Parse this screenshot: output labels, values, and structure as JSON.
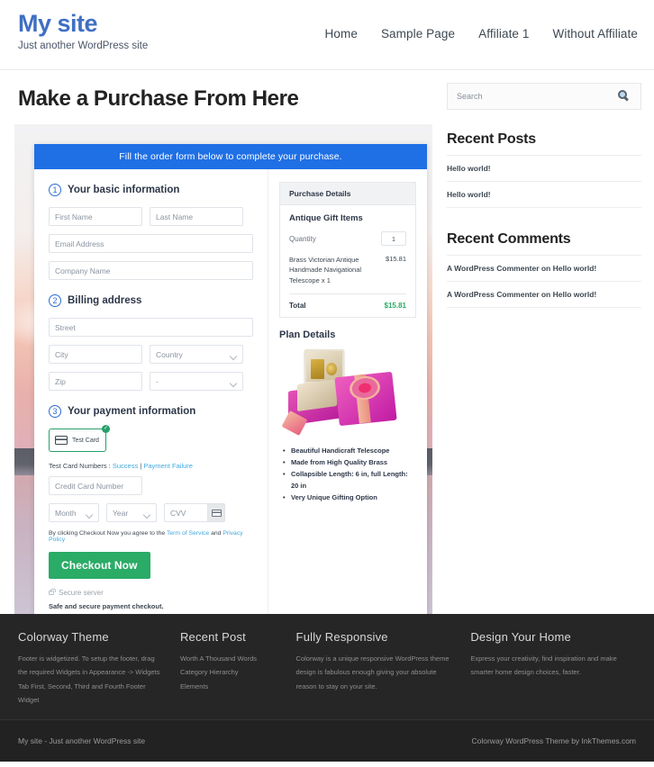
{
  "header": {
    "site_title": "My site",
    "tagline": "Just another WordPress site",
    "nav": [
      {
        "label": "Home"
      },
      {
        "label": "Sample Page"
      },
      {
        "label": "Affiliate 1"
      },
      {
        "label": "Without Affiliate"
      }
    ]
  },
  "page": {
    "title": "Make a Purchase From Here"
  },
  "checkout": {
    "banner": "Fill the order form below to complete your purchase.",
    "step1": {
      "num": "1",
      "label": "Your basic information",
      "first_name_placeholder": "First Name",
      "last_name_placeholder": "Last Name",
      "email_placeholder": "Email Address",
      "company_placeholder": "Company Name"
    },
    "step2": {
      "num": "2",
      "label": "Billing address",
      "street_placeholder": "Street",
      "city_placeholder": "City",
      "country_placeholder": "Country",
      "zip_placeholder": "Zip",
      "state_placeholder": "-"
    },
    "step3": {
      "num": "3",
      "label": "Your payment information",
      "test_card_label": "Test Card",
      "check_badge": "✓",
      "test_numbers_prefix": "Test Card Numbers : ",
      "test_numbers_success": "Success",
      "test_numbers_sep": " | ",
      "test_numbers_failure": "Payment Failure",
      "card_number_placeholder": "Credit Card Number",
      "month_placeholder": "Month",
      "year_placeholder": "Year",
      "cvv_placeholder": "CVV",
      "terms_prefix": "By clicking Checkout Now you agree to the ",
      "terms_tos": "Term of Service",
      "terms_mid": " and ",
      "terms_privacy": "Privacy Policy",
      "checkout_button": "Checkout Now",
      "secure_server": "Secure server",
      "safe_line": "Safe and secure payment checkout."
    },
    "purchase_details": {
      "panel_title": "Purchase Details",
      "product_group": "Antique Gift Items",
      "quantity_label": "Quantity",
      "quantity_value": "1",
      "item_name": "Brass Victorian Antique Handmade Navigational Telescope x 1",
      "item_price": "$15.81",
      "total_label": "Total",
      "total_value": "$15.81"
    },
    "plan_details": {
      "title": "Plan Details",
      "features": [
        "Beautiful Handicraft Telescope",
        "Made from High Quality Brass",
        "Collapsible Length: 6 in, full Length: 20 in",
        "Very Unique Gifting Option"
      ]
    }
  },
  "sidebar": {
    "search_placeholder": "Search",
    "recent_posts": {
      "title": "Recent Posts",
      "items": [
        {
          "label": "Hello world!"
        },
        {
          "label": "Hello world!"
        }
      ]
    },
    "recent_comments": {
      "title": "Recent Comments",
      "items": [
        {
          "label": "A WordPress Commenter on Hello world!"
        },
        {
          "label": "A WordPress Commenter on Hello world!"
        }
      ]
    }
  },
  "footer": {
    "columns": [
      {
        "title": "Colorway Theme",
        "text": "Footer is widgetized. To setup the footer, drag the required Widgets in Appearance -> Widgets Tab First, Second, Third and Fourth Footer Widget"
      },
      {
        "title": "Recent Post",
        "items": [
          {
            "label": "Worth A Thousand Words"
          },
          {
            "label": "Category Hierarchy"
          },
          {
            "label": "Elements"
          }
        ]
      },
      {
        "title": "Fully Responsive",
        "text": "Colorway is a unique responsive WordPress theme design is fabulous enough giving your absolute reason to stay on your site."
      },
      {
        "title": "Design Your Home",
        "text": "Express your creativity, find inspiration and make smarter home design choices, faster."
      }
    ],
    "bottom_left": "My site - Just another WordPress site",
    "bottom_right": "Colorway WordPress Theme by InkThemes.com"
  },
  "colors": {
    "brand_blue": "#3f6fc4",
    "banner_blue": "#1f6fe5",
    "accent_green": "#2aab66",
    "link_blue": "#3fa7e0",
    "footer_dark": "#262626"
  }
}
